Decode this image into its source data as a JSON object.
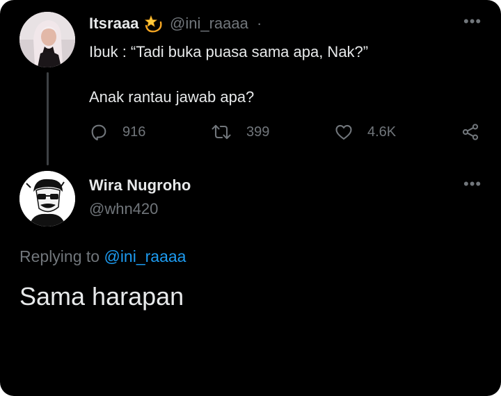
{
  "original_tweet": {
    "name": "Itsraaa",
    "name_emoji_icon": "dizzy-star-emoji",
    "handle": "@ini_raaaa",
    "separator": "·",
    "more_label": "•••",
    "text_line_1": "Ibuk : “Tadi buka puasa sama apa, Nak?”",
    "text_line_2": "Anak rantau jawab apa?",
    "stats": {
      "replies": "916",
      "retweets": "399",
      "likes": "4.6K"
    }
  },
  "reply_tweet": {
    "name": "Wira Nugroho",
    "handle": "@whn420",
    "more_label": "•••",
    "replying_prefix": "Replying to",
    "replying_mention": "@ini_raaaa",
    "text": "Sama harapan"
  },
  "colors": {
    "background": "#000000",
    "primary_text": "#e7e9ea",
    "secondary_text": "#71767b",
    "link": "#1d9bf0",
    "thread_line": "#3e4144"
  }
}
